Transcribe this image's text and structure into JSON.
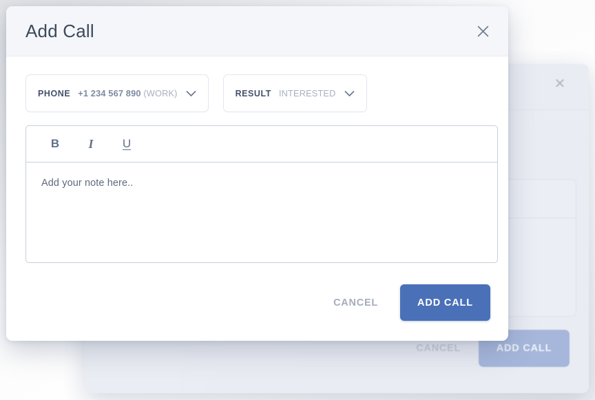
{
  "theme": {
    "primary": "#4a70b8",
    "primary_muted": "#7e97cc",
    "header_bg": "#f4f6fa",
    "dialog_bg": "#ffffff",
    "text_dark": "#3d4a5c",
    "text_muted": "#a4adbd",
    "border": "#c7cfdb"
  },
  "dialog": {
    "title": "Add Call",
    "close_icon": "close-icon",
    "fields": {
      "phone": {
        "label": "PHONE",
        "value": "+1 234 567 890",
        "value_suffix": "(WORK)",
        "chevron_icon": "chevron-down-icon"
      },
      "result": {
        "label": "RESULT",
        "value": "INTERESTED",
        "chevron_icon": "chevron-down-icon"
      }
    },
    "editor": {
      "toolbar": [
        {
          "name": "bold-button",
          "glyph": "B"
        },
        {
          "name": "italic-button",
          "glyph": "I"
        },
        {
          "name": "underline-button",
          "glyph": "U"
        }
      ],
      "placeholder": "Add your note here..",
      "value": ""
    },
    "footer": {
      "cancel_label": "CANCEL",
      "submit_label": "ADD CALL"
    }
  },
  "background_dialog": {
    "close_icon": "close-icon",
    "footer": {
      "cancel_label": "CANCEL",
      "submit_label": "ADD CALL"
    }
  }
}
